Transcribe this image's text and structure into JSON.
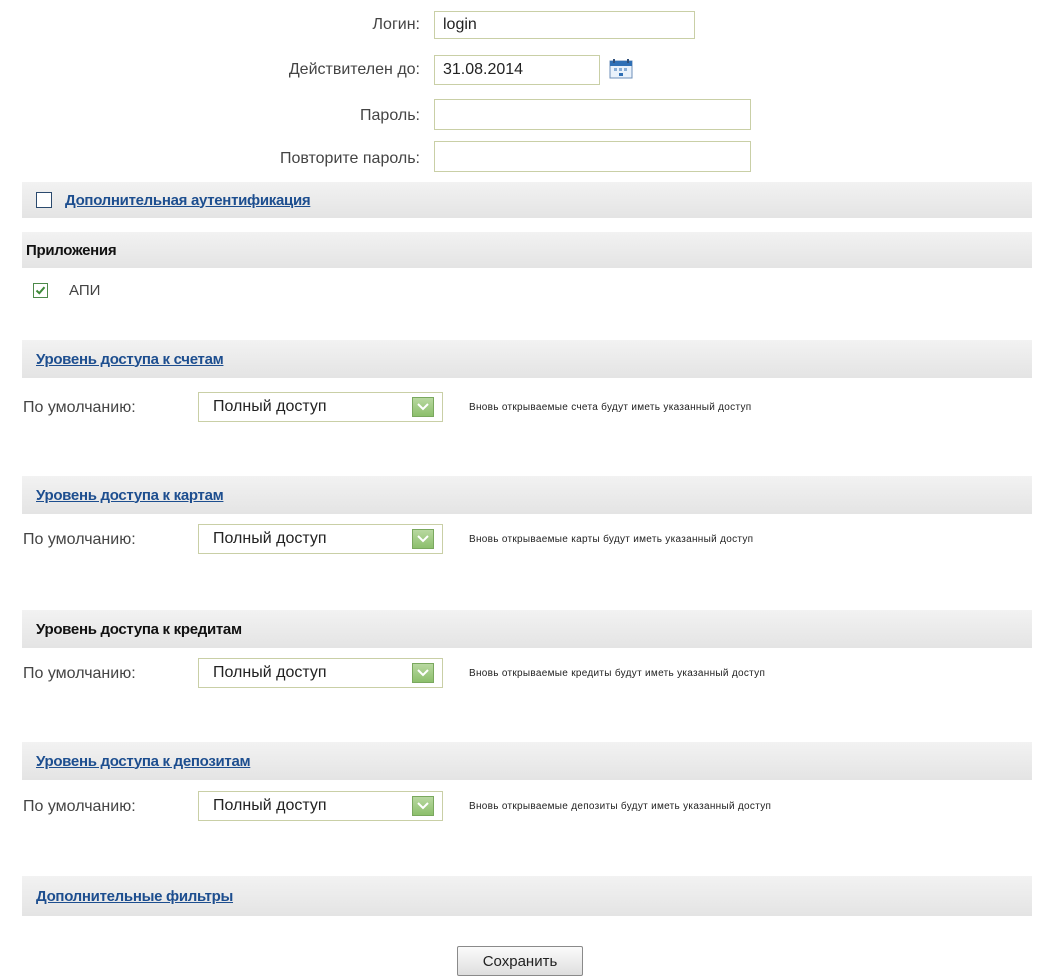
{
  "form": {
    "login_label": "Логин:",
    "login_value": "login",
    "valid_until_label": "Действителен до:",
    "valid_until_value": "31.08.2014",
    "password_label": "Пароль:",
    "password_value": "",
    "repeat_password_label": "Повторите пароль:",
    "repeat_password_value": ""
  },
  "extra_auth": {
    "checked": false,
    "label": "Дополнительная аутентификация"
  },
  "applications": {
    "title": "Приложения",
    "items": [
      {
        "label": "АПИ",
        "checked": true
      }
    ]
  },
  "access_sections": [
    {
      "title": "Уровень доступа к счетам",
      "is_link": true,
      "default_label": "По умолчанию:",
      "selected": "Полный доступ",
      "note": "Вновь открываемые счета будут иметь указанный доступ"
    },
    {
      "title": "Уровень доступа к картам",
      "is_link": true,
      "default_label": "По умолчанию:",
      "selected": "Полный доступ",
      "note": "Вновь открываемые карты будут иметь указанный доступ"
    },
    {
      "title": "Уровень доступа к кредитам",
      "is_link": false,
      "default_label": "По умолчанию:",
      "selected": "Полный доступ",
      "note": "Вновь открываемые кредиты будут иметь указанный доступ"
    },
    {
      "title": "Уровень доступа к депозитам",
      "is_link": true,
      "default_label": "По умолчанию:",
      "selected": "Полный доступ",
      "note": "Вновь открываемые депозиты будут иметь указанный доступ"
    }
  ],
  "extra_filters": {
    "label": "Дополнительные фильтры"
  },
  "actions": {
    "save_label": "Сохранить"
  },
  "icons": {
    "calendar": "calendar-icon",
    "checkmark": "checkmark-icon",
    "dropdown": "chevron-down-icon"
  },
  "colors": {
    "link": "#1d4e8f",
    "section_bg": "#e8e8e8",
    "input_border": "#c9cfa6",
    "check_green": "#3f8a3a",
    "select_arrow": "#8cbf6c"
  }
}
